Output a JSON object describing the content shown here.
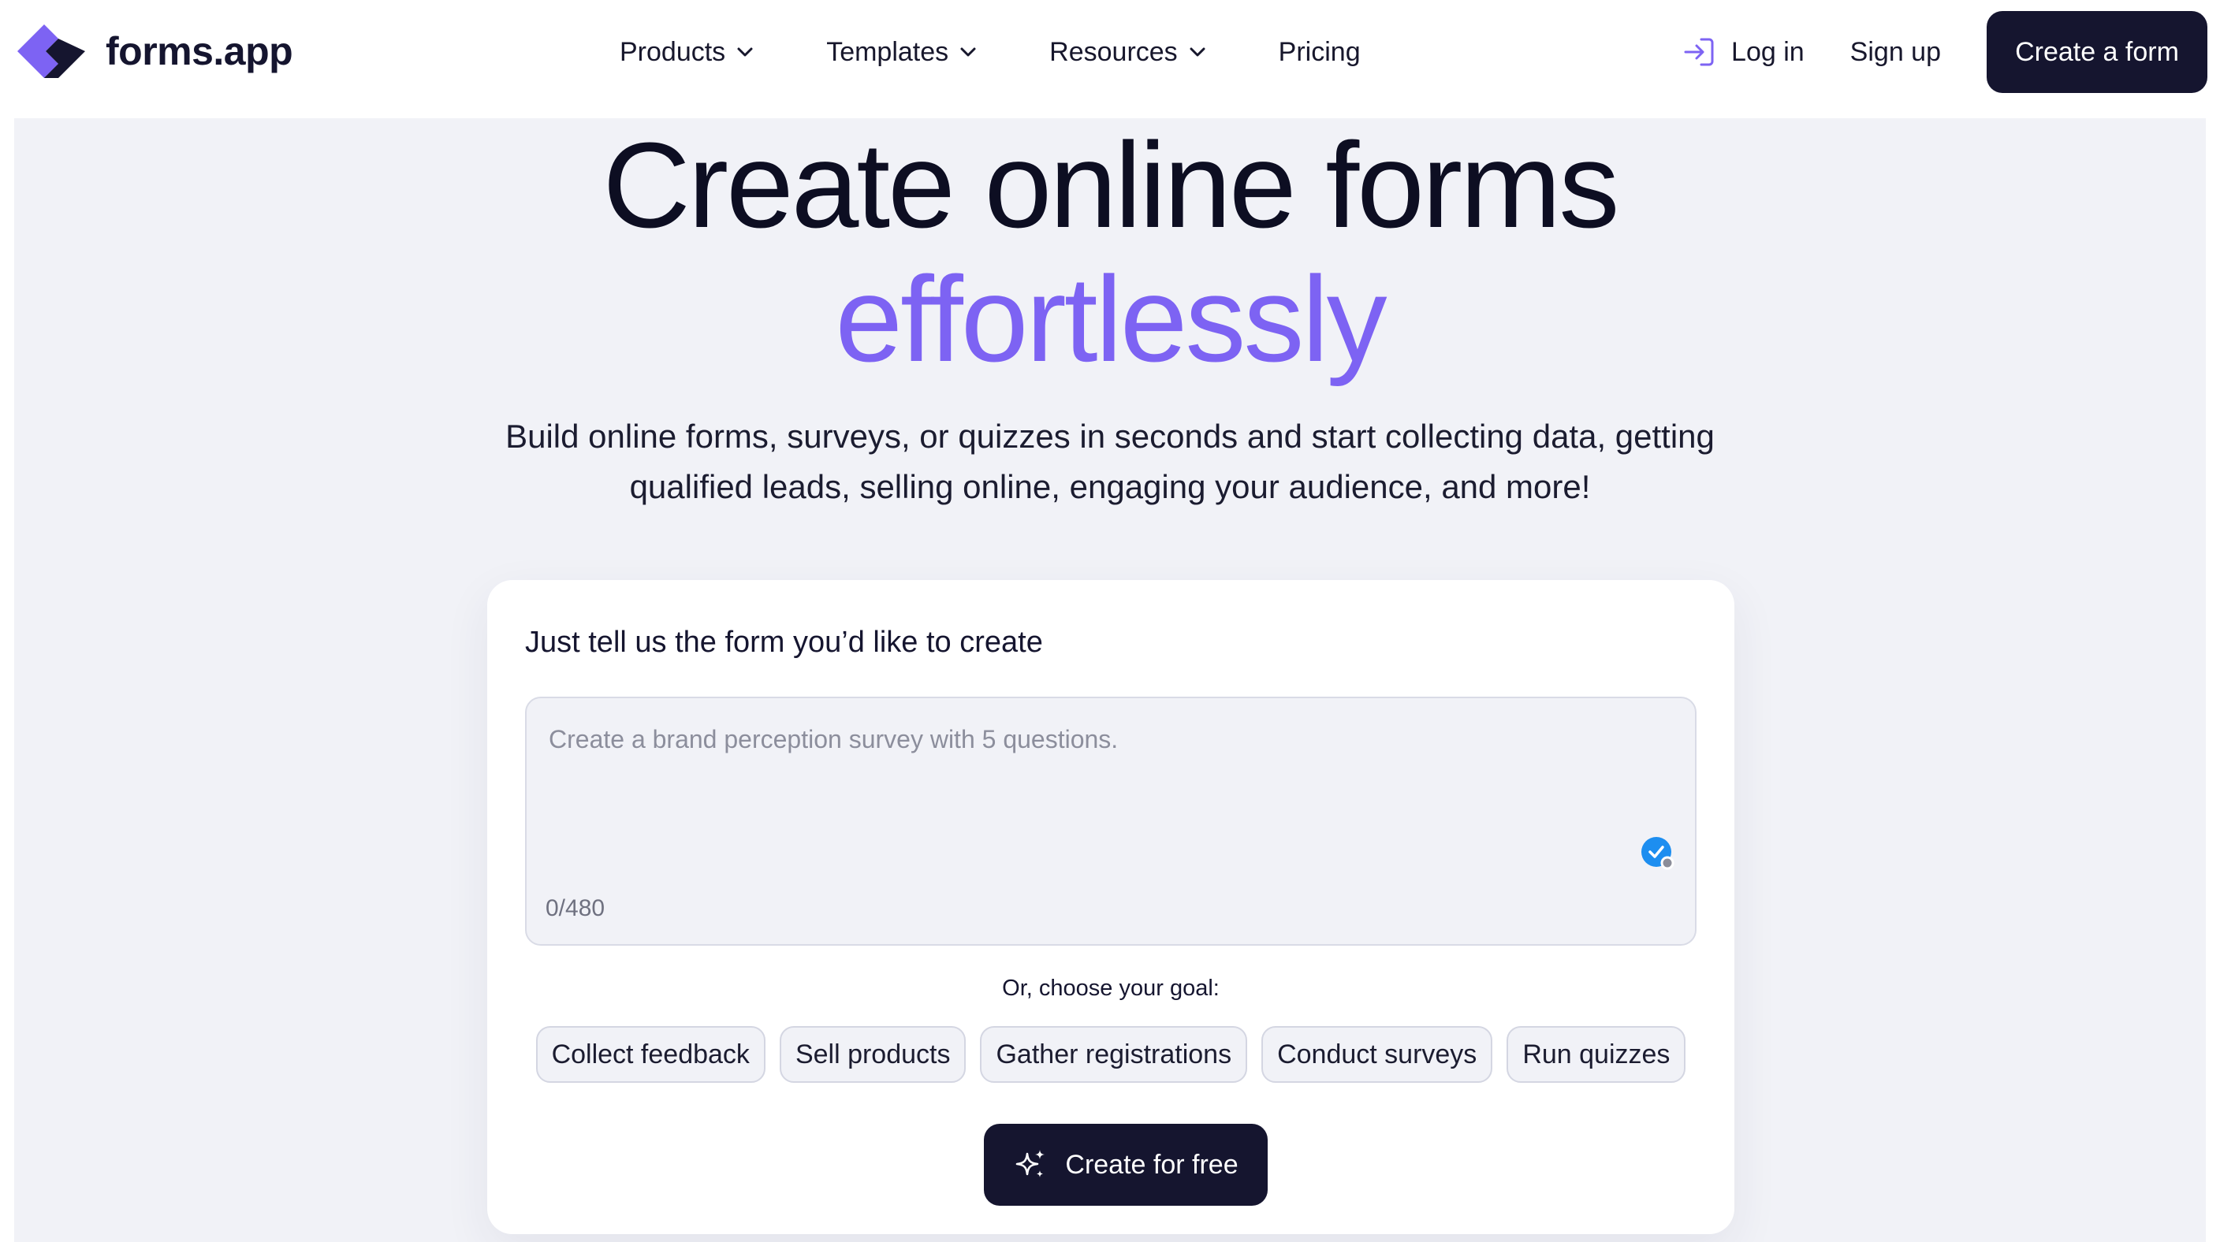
{
  "brand": {
    "name": "forms.app",
    "logo_icon": "forms-app-logo-mark",
    "accent_color": "#7d63f3",
    "dark_color": "#15152f"
  },
  "nav": {
    "links": [
      {
        "label": "Products",
        "has_dropdown": true
      },
      {
        "label": "Templates",
        "has_dropdown": true
      },
      {
        "label": "Resources",
        "has_dropdown": true
      },
      {
        "label": "Pricing",
        "has_dropdown": false
      }
    ],
    "login_label": "Log in",
    "login_icon": "login-arrow-icon",
    "signup_label": "Sign up",
    "cta_label": "Create a form"
  },
  "hero": {
    "title_line1": "Create online forms",
    "title_line2": "effortlessly",
    "subtitle_line1": "Build online forms, surveys, or quizzes in seconds and start collecting data, getting",
    "subtitle_line2": "qualified leads, selling online, engaging your audience, and more!"
  },
  "generator": {
    "title": "Just tell us the form you’d like to create",
    "input_value": "",
    "input_placeholder": "Create a brand perception survey with 5 questions.",
    "counter": "0/480",
    "goal_label": "Or, choose your goal:",
    "goals": [
      "Collect feedback",
      "Sell products",
      "Gather registrations",
      "Conduct surveys",
      "Run quizzes"
    ],
    "submit_label": "Create for free",
    "submit_icon": "sparkle-icon"
  }
}
